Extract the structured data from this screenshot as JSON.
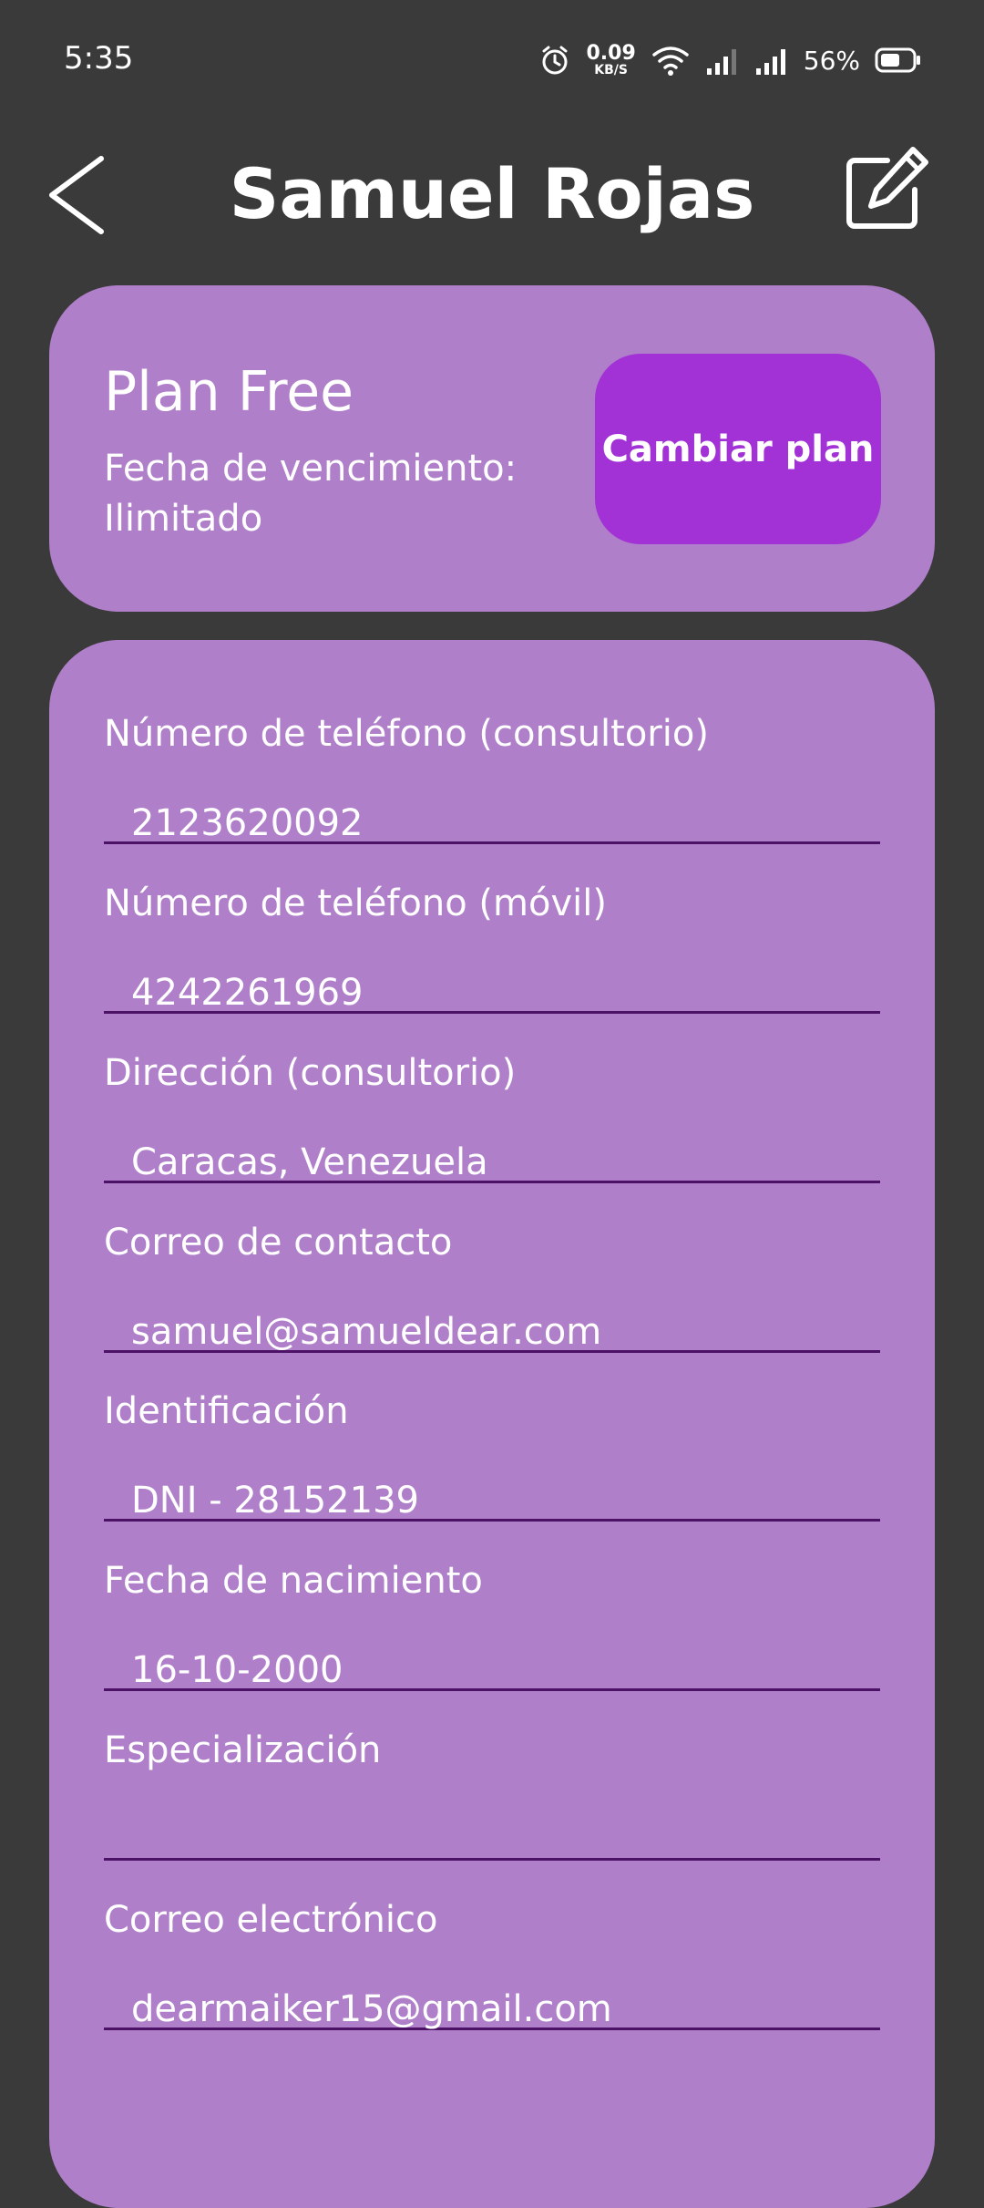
{
  "status_bar": {
    "time": "5:35",
    "net_speed_value": "0.09",
    "net_speed_unit": "KB/S",
    "battery_percent": "56%"
  },
  "header": {
    "title": "Samuel Rojas"
  },
  "plan": {
    "name": "Plan Free",
    "expiry_label": "Fecha de vencimiento:",
    "expiry_value": "Ilimitado",
    "change_button_label": "Cambiar plan"
  },
  "fields": [
    {
      "label": "Número de teléfono (consultorio)",
      "value": "2123620092"
    },
    {
      "label": "Número de teléfono (móvil)",
      "value": "4242261969"
    },
    {
      "label": "Dirección (consultorio)",
      "value": "Caracas, Venezuela"
    },
    {
      "label": "Correo de contacto",
      "value": "samuel@samueldear.com"
    },
    {
      "label": "Identificación",
      "value": "DNI - 28152139"
    },
    {
      "label": "Fecha de nacimiento",
      "value": "16-10-2000"
    },
    {
      "label": "Especialización",
      "value": ""
    },
    {
      "label": "Correo electrónico",
      "value": "dearmaiker15@gmail.com"
    }
  ],
  "colors": {
    "background": "#3a3a3a",
    "card": "#b07fca",
    "accent_button": "#a231d6",
    "underline": "#4b1266"
  }
}
